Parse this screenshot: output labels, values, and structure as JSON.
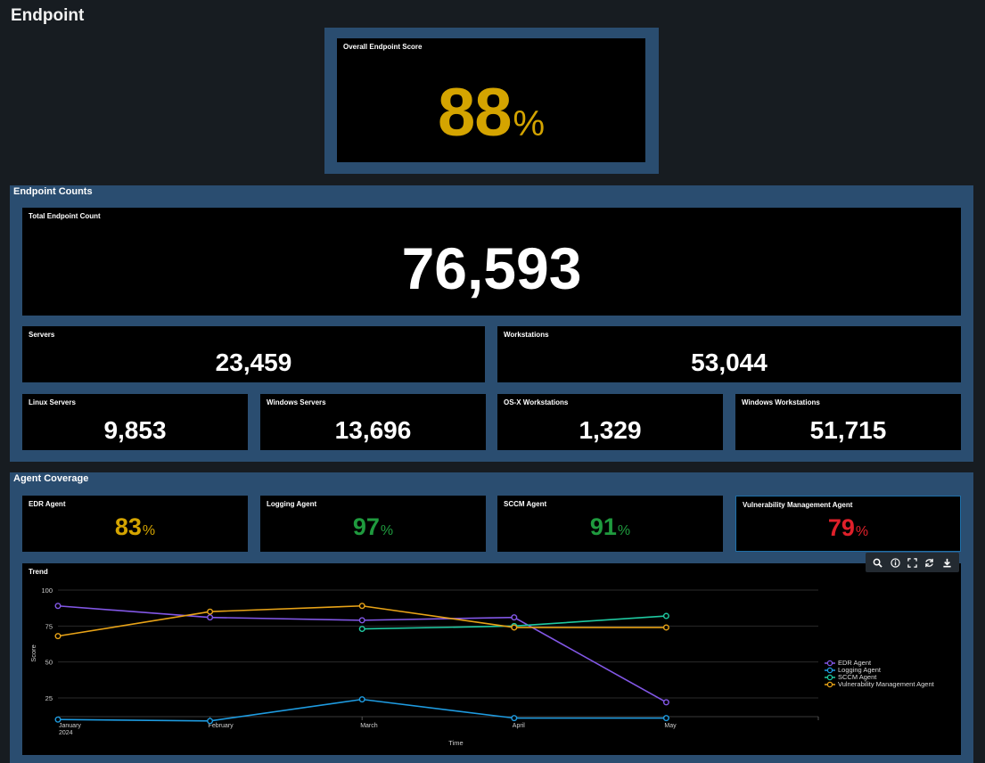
{
  "page": {
    "title": "Endpoint"
  },
  "overall": {
    "label": "Overall Endpoint Score",
    "value": "88",
    "unit": "%",
    "color": "#d4a400"
  },
  "counts": {
    "title": "Endpoint Counts",
    "total": {
      "label": "Total Endpoint Count",
      "value": "76,593"
    },
    "servers": {
      "label": "Servers",
      "value": "23,459"
    },
    "workstations": {
      "label": "Workstations",
      "value": "53,044"
    },
    "linux_servers": {
      "label": "Linux Servers",
      "value": "9,853"
    },
    "windows_servers": {
      "label": "Windows Servers",
      "value": "13,696"
    },
    "osx_workstations": {
      "label": "OS-X Workstations",
      "value": "1,329"
    },
    "windows_workstations": {
      "label": "Windows Workstations",
      "value": "51,715"
    }
  },
  "coverage": {
    "title": "Agent Coverage",
    "edr": {
      "label": "EDR Agent",
      "value": "83",
      "unit": "%",
      "color": "#d4a400"
    },
    "logging": {
      "label": "Logging Agent",
      "value": "97",
      "unit": "%",
      "color": "#1f9a3e"
    },
    "sccm": {
      "label": "SCCM Agent",
      "value": "91",
      "unit": "%",
      "color": "#1f9a3e"
    },
    "vuln": {
      "label": "Vulnerability Management Agent",
      "value": "79",
      "unit": "%",
      "color": "#e0202a"
    }
  },
  "trend": {
    "label": "Trend",
    "toolbar": [
      "search-icon",
      "info-icon",
      "expand-icon",
      "refresh-icon",
      "download-icon"
    ]
  },
  "chart_data": {
    "type": "line",
    "title": "Trend",
    "xlabel": "Time",
    "ylabel": "Score",
    "x": [
      "January",
      "February",
      "March",
      "April",
      "May"
    ],
    "x_sublabel": "2024",
    "yticks": [
      25,
      50,
      75,
      100
    ],
    "ylim": [
      12,
      100
    ],
    "grid": true,
    "legend": "right",
    "series": [
      {
        "name": "EDR Agent",
        "color": "#8257e6",
        "values": [
          89,
          81,
          79,
          81,
          22
        ]
      },
      {
        "name": "Logging Agent",
        "color": "#1e9be0",
        "values": [
          10,
          9,
          24,
          11,
          11
        ]
      },
      {
        "name": "SCCM Agent",
        "color": "#1fc9a1",
        "values": [
          null,
          null,
          73,
          75,
          82
        ]
      },
      {
        "name": "Vulnerability Management Agent",
        "color": "#e8a317",
        "values": [
          68,
          85,
          89,
          74,
          74
        ]
      }
    ]
  }
}
